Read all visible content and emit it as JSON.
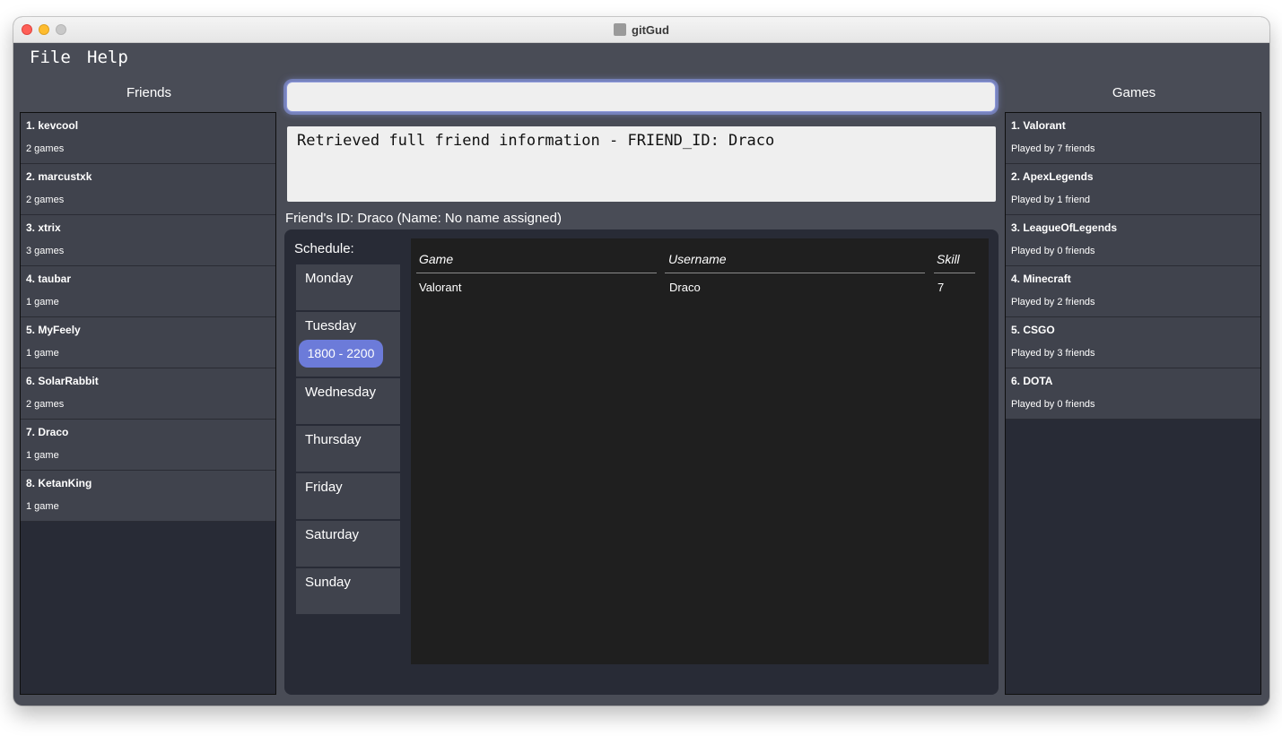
{
  "window": {
    "title": "gitGud"
  },
  "menu": {
    "file": "File",
    "help": "Help"
  },
  "friends_panel": {
    "header": "Friends",
    "items": [
      {
        "title": "1. kevcool",
        "sub": "2 games"
      },
      {
        "title": "2. marcustxk",
        "sub": "2 games"
      },
      {
        "title": "3. xtrix",
        "sub": "3 games"
      },
      {
        "title": "4. taubar",
        "sub": "1 game"
      },
      {
        "title": "5. MyFeely",
        "sub": "1 game"
      },
      {
        "title": "6. SolarRabbit",
        "sub": "2 games"
      },
      {
        "title": "7. Draco",
        "sub": "1 game"
      },
      {
        "title": "8. KetanKing",
        "sub": "1 game"
      }
    ]
  },
  "games_panel": {
    "header": "Games",
    "items": [
      {
        "title": "1. Valorant",
        "sub": "Played by 7 friends"
      },
      {
        "title": "2. ApexLegends",
        "sub": "Played by 1 friend"
      },
      {
        "title": "3. LeagueOfLegends",
        "sub": "Played by 0 friends"
      },
      {
        "title": "4. Minecraft",
        "sub": "Played by 2 friends"
      },
      {
        "title": "5. CSGO",
        "sub": "Played by 3 friends"
      },
      {
        "title": "6. DOTA",
        "sub": "Played by 0 friends"
      }
    ]
  },
  "command": {
    "value": "",
    "placeholder": ""
  },
  "result": {
    "text": "Retrieved full friend information - FRIEND_ID: Draco"
  },
  "friend_detail": {
    "id_line": "Friend's ID: Draco (Name: No name assigned)",
    "schedule_label": "Schedule:",
    "days": [
      {
        "name": "Monday",
        "slot": ""
      },
      {
        "name": "Tuesday",
        "slot": "1800 - 2200"
      },
      {
        "name": "Wednesday",
        "slot": ""
      },
      {
        "name": "Thursday",
        "slot": ""
      },
      {
        "name": "Friday",
        "slot": ""
      },
      {
        "name": "Saturday",
        "slot": ""
      },
      {
        "name": "Sunday",
        "slot": ""
      }
    ],
    "table": {
      "headers": {
        "game": "Game",
        "username": "Username",
        "skill": "Skill"
      },
      "rows": [
        {
          "game": "Valorant",
          "username": "Draco",
          "skill": "7"
        }
      ]
    }
  },
  "colors": {
    "window_bg": "#494c56",
    "list_bg": "#282b36",
    "card_bg": "#40434d",
    "slot_accent": "#6c7bd9",
    "table_bg": "#1f1f1f"
  }
}
